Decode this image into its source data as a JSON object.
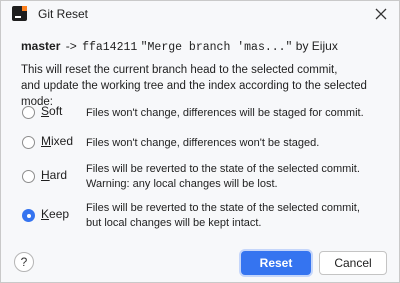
{
  "window": {
    "title": "Git Reset",
    "icon": "intellij-app-icon",
    "close_icon": "close-icon"
  },
  "header": {
    "branch": "master",
    "arrow": "->",
    "hash": "ffa14211",
    "message": "\"Merge branch 'mas...\"",
    "by": "by Eijux"
  },
  "description": {
    "line1": "This will reset the current branch head to the selected commit,",
    "line2": "and update the working tree and the index according to the selected mode:"
  },
  "options": [
    {
      "mnemonic": "S",
      "rest": "oft",
      "desc1": "Files won't change, differences will be staged for commit.",
      "desc2": "",
      "checked": false
    },
    {
      "mnemonic": "M",
      "rest": "ixed",
      "desc1": "Files won't change, differences won't be staged.",
      "desc2": "",
      "checked": false
    },
    {
      "mnemonic": "H",
      "rest": "ard",
      "desc1": "Files will be reverted to the state of the selected commit.",
      "desc2": "Warning: any local changes will be lost.",
      "checked": false
    },
    {
      "mnemonic": "K",
      "rest": "eep",
      "desc1": "Files will be reverted to the state of the selected commit,",
      "desc2": "but local changes will be kept intact.",
      "checked": true
    }
  ],
  "footer": {
    "help_label": "?",
    "reset_label": "Reset",
    "cancel_label": "Cancel"
  },
  "colors": {
    "accent": "#3574f0",
    "background": "#f7f8fa"
  }
}
